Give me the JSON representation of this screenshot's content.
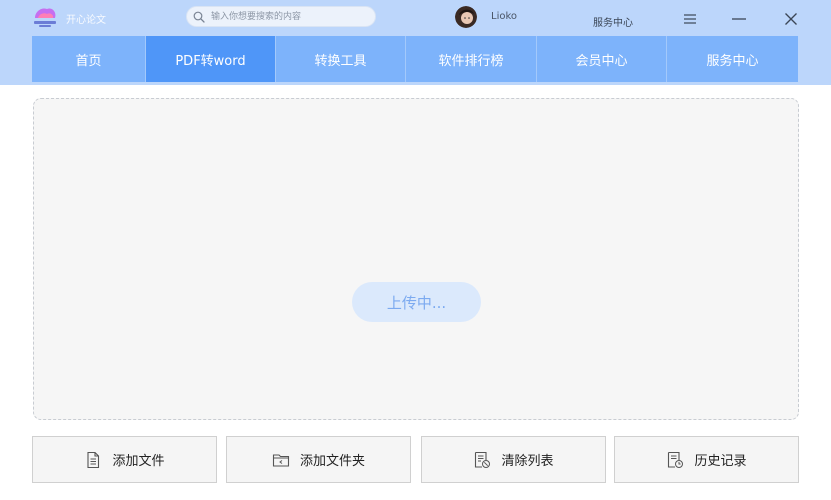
{
  "header": {
    "logo_text": "开心论文",
    "search_placeholder": "输入你想要搜索的内容",
    "username": "Lioko",
    "service_link": "服务中心"
  },
  "nav": {
    "tabs": [
      {
        "label": "首页",
        "active": false
      },
      {
        "label": "PDF转word",
        "active": true
      },
      {
        "label": "转换工具",
        "active": false
      },
      {
        "label": "软件排行榜",
        "active": false
      },
      {
        "label": "会员中心",
        "active": false
      },
      {
        "label": "服务中心",
        "active": false
      }
    ]
  },
  "main": {
    "upload_status": "上传中..."
  },
  "actions": [
    {
      "label": "添加文件",
      "icon": "file-icon"
    },
    {
      "label": "添加文件夹",
      "icon": "folder-icon"
    },
    {
      "label": "清除列表",
      "icon": "clear-list-icon"
    },
    {
      "label": "历史记录",
      "icon": "history-icon"
    }
  ],
  "colors": {
    "header_bg": "#bcd6fb",
    "tab_bg": "#7db3fb",
    "tab_active_bg": "#4f96f8",
    "upload_pill_bg": "#dbe9fc",
    "upload_pill_text": "#7caaf0"
  }
}
